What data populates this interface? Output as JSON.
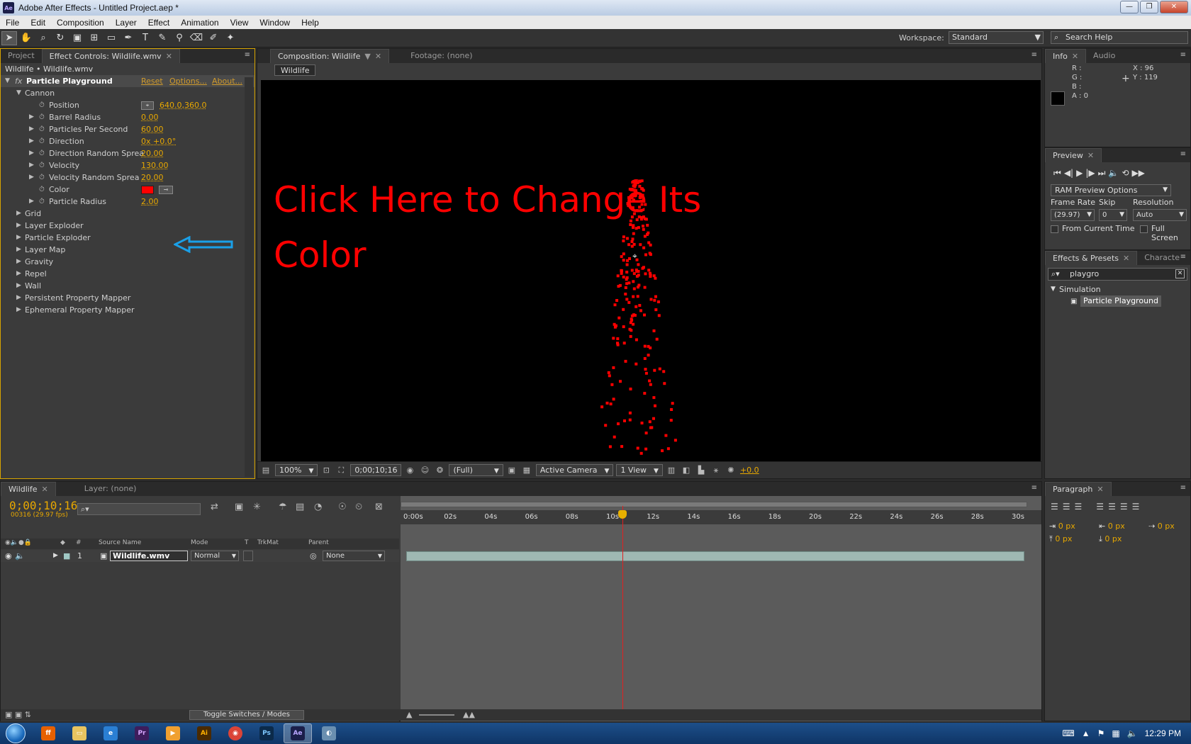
{
  "window": {
    "title": "Adobe After Effects - Untitled Project.aep *",
    "app_icon": "Ae"
  },
  "menu": [
    "File",
    "Edit",
    "Composition",
    "Layer",
    "Effect",
    "Animation",
    "View",
    "Window",
    "Help"
  ],
  "toolbar": {
    "workspace_label": "Workspace:",
    "workspace_value": "Standard",
    "search_placeholder": "Search Help"
  },
  "left_panel": {
    "tabs": [
      "Project",
      "Effect Controls: Wildlife.wmv"
    ],
    "header": "Wildlife • Wildlife.wmv",
    "effect": {
      "name": "Particle Playground",
      "reset": "Reset",
      "options": "Options...",
      "about": "About..."
    },
    "cannon_label": "Cannon",
    "properties": [
      {
        "label": "Position",
        "value": "640.0,360.0"
      },
      {
        "label": "Barrel Radius",
        "value": "0.00"
      },
      {
        "label": "Particles Per Second",
        "value": "60.00"
      },
      {
        "label": "Direction",
        "value": "0x +0.0°"
      },
      {
        "label": "Direction Random Sprea",
        "value": "20.00"
      },
      {
        "label": "Velocity",
        "value": "130.00"
      },
      {
        "label": "Velocity Random Sprea",
        "value": "20.00"
      },
      {
        "label": "Color",
        "value": ""
      },
      {
        "label": "Particle Radius",
        "value": "2.00"
      }
    ],
    "color_value": "#ff0000",
    "groups": [
      "Grid",
      "Layer Exploder",
      "Particle Exploder",
      "Layer Map",
      "Gravity",
      "Repel",
      "Wall",
      "Persistent Property Mapper",
      "Ephemeral Property Mapper"
    ]
  },
  "composition": {
    "tabs": [
      "Composition: Wildlife",
      "Footage: (none)"
    ],
    "chip": "Wildlife",
    "overlay_text": "Click Here to Change Its Color",
    "zoom": "100%",
    "timecode": "0;00;10;16",
    "resolution": "(Full)",
    "camera": "Active Camera",
    "view": "1 View",
    "exposure": "+0.0"
  },
  "info": {
    "tabs": [
      "Info",
      "Audio"
    ],
    "r": "R :",
    "g": "G :",
    "b": "B :",
    "a": "A : 0",
    "x": "X : 96",
    "y": "Y : 119"
  },
  "preview": {
    "tab": "Preview",
    "ram_options": "RAM Preview Options",
    "frame_rate_label": "Frame Rate",
    "skip_label": "Skip",
    "resolution_label": "Resolution",
    "frame_rate": "(29.97)",
    "skip": "0",
    "resolution": "Auto",
    "from_current": "From Current Time",
    "full_screen": "Full Screen"
  },
  "effects_presets": {
    "tabs": [
      "Effects & Presets",
      "Characte"
    ],
    "search_value": "playgro",
    "category": "Simulation",
    "item": "Particle Playground"
  },
  "timeline": {
    "tabs": [
      "Wildlife",
      "Layer: (none)"
    ],
    "timecode": "0;00;10;16",
    "frames": "00316 (29.97 fps)",
    "columns": {
      "num": "#",
      "source": "Source Name",
      "mode": "Mode",
      "t": "T",
      "trkmat": "TrkMat",
      "parent": "Parent"
    },
    "layer": {
      "index": "1",
      "name": "Wildlife.wmv",
      "mode": "Normal",
      "parent": "None"
    },
    "ruler": [
      "0:00s",
      "02s",
      "04s",
      "06s",
      "08s",
      "10s",
      "12s",
      "14s",
      "16s",
      "18s",
      "20s",
      "22s",
      "24s",
      "26s",
      "28s",
      "30s"
    ],
    "current_time_s": 10.53,
    "duration_s": 30,
    "toggle_label": "Toggle Switches / Modes"
  },
  "paragraph": {
    "tab": "Paragraph",
    "indent_left": "0 px",
    "indent_right": "0 px",
    "first_line": "0 px",
    "space_before": "0 px",
    "space_after": "0 px"
  },
  "taskbar": {
    "apps": [
      "Firefox",
      "Explorer",
      "Internet Explorer",
      "Premiere",
      "Media",
      "Illustrator",
      "Chrome",
      "Photoshop",
      "After Effects",
      "Other"
    ],
    "clock": "12:29 PM"
  }
}
